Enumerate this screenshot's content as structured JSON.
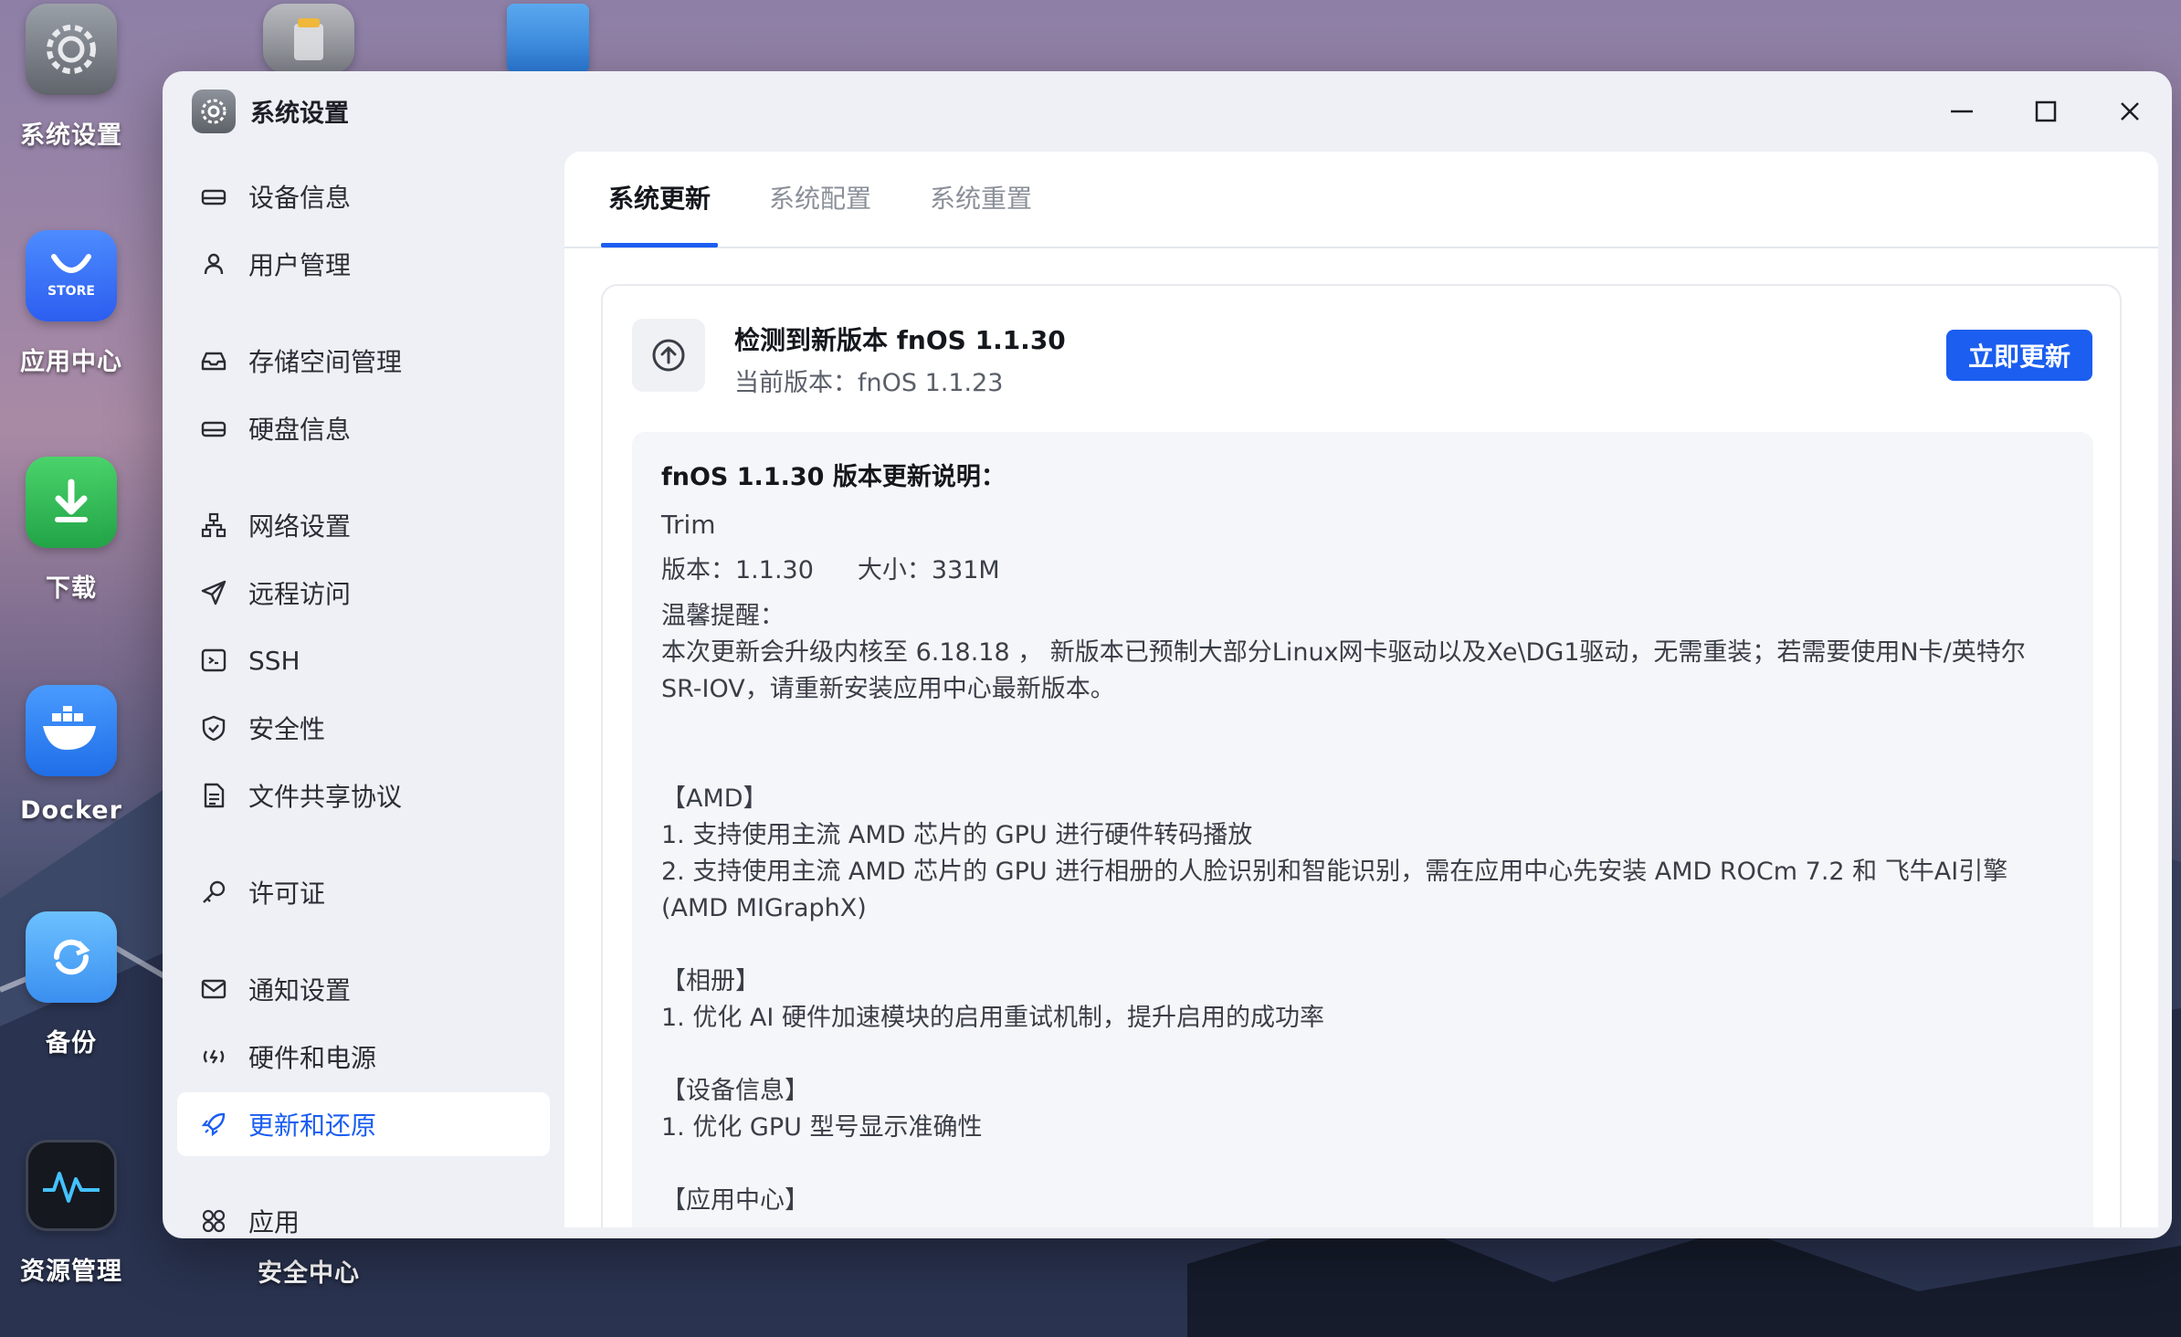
{
  "desktop": {
    "icons": [
      {
        "label": "系统设置",
        "icon": "gear-icon"
      },
      {
        "label": "应用中心",
        "icon": "store-icon",
        "badge": "STORE"
      },
      {
        "label": "下载",
        "icon": "download-icon"
      },
      {
        "label": "Docker",
        "icon": "docker-icon"
      },
      {
        "label": "备份",
        "icon": "backup-icon"
      },
      {
        "label": "资源管理",
        "icon": "activity-icon"
      },
      {
        "label": "安全中心",
        "icon": "shield-icon"
      }
    ]
  },
  "window": {
    "title": "系统设置",
    "controls": {
      "minimize": "minimize-icon",
      "maximize": "maximize-icon",
      "close": "close-icon"
    }
  },
  "sidebar": {
    "items": [
      {
        "label": "设备信息",
        "icon": "drive-icon"
      },
      {
        "label": "用户管理",
        "icon": "user-icon"
      },
      {
        "label": "存储空间管理",
        "icon": "storage-icon"
      },
      {
        "label": "硬盘信息",
        "icon": "disk-icon"
      },
      {
        "label": "网络设置",
        "icon": "network-icon"
      },
      {
        "label": "远程访问",
        "icon": "send-icon"
      },
      {
        "label": "SSH",
        "icon": "terminal-icon"
      },
      {
        "label": "安全性",
        "icon": "shield-check-icon"
      },
      {
        "label": "文件共享协议",
        "icon": "document-icon"
      },
      {
        "label": "许可证",
        "icon": "key-icon"
      },
      {
        "label": "通知设置",
        "icon": "mail-icon"
      },
      {
        "label": "硬件和电源",
        "icon": "power-icon"
      },
      {
        "label": "更新和还原",
        "icon": "rocket-icon",
        "active": true
      },
      {
        "label": "应用",
        "icon": "apps-grid-icon"
      }
    ]
  },
  "tabs": [
    {
      "label": "系统更新",
      "active": true
    },
    {
      "label": "系统配置"
    },
    {
      "label": "系统重置"
    }
  ],
  "update": {
    "title": "检测到新版本 fnOS 1.1.30",
    "current": "当前版本：fnOS 1.1.23",
    "button": "立即更新"
  },
  "notes": {
    "heading": "fnOS 1.1.30 版本更新说明：",
    "name": "Trim",
    "version": "版本：1.1.30",
    "size": "大小：331M",
    "tip_title": "温馨提醒：",
    "tip_body": "本次更新会升级内核至 6.18.18 ， 新版本已预制大部分Linux网卡驱动以及Xe\\DG1驱动，无需重装；若需要使用N卡/英特尔SR-IOV，请重新安装应用中心最新版本。",
    "amd_title": "【AMD】",
    "amd_1": "1. 支持使用主流 AMD 芯片的 GPU 进行硬件转码播放",
    "amd_2": "2. 支持使用主流 AMD 芯片的 GPU 进行相册的人脸识别和智能识别，需在应用中心先安装 AMD ROCm 7.2 和 飞牛AI引擎(AMD MIGraphX)",
    "album_title": "【相册】",
    "album_1": "1. 优化 AI 硬件加速模块的启用重试机制，提升启用的成功率",
    "device_title": "【设备信息】",
    "device_1": "1. 优化 GPU 型号显示准确性",
    "appcenter_title": "【应用中心】"
  },
  "colors": {
    "accent": "#1b5ef0",
    "window_bg": "#eef0f5",
    "panel_bg": "#ffffff"
  }
}
